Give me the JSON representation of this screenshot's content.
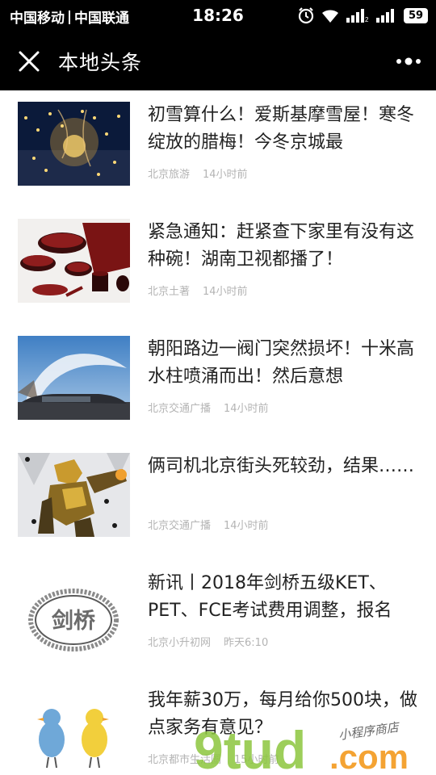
{
  "status_bar": {
    "carrier1": "中国移动",
    "carrier2": "中国联通",
    "time": "18:26",
    "battery": "59",
    "icons": [
      "alarm-icon",
      "wifi-icon",
      "signal-icon",
      "signal-icon"
    ]
  },
  "title_bar": {
    "title": "本地头条",
    "close_icon": "close-icon",
    "more_icon": "more-icon"
  },
  "articles": [
    {
      "title": "初雪算什么！爱斯基摩雪屋！寒冬绽放的腊梅！今冬京城最",
      "source": "北京旅游",
      "time": "14小时前",
      "image": "snow-lights-image"
    },
    {
      "title": "紧急通知：赶紧查下家里有没有这种碗！湖南卫视都播了！",
      "source": "北京土著",
      "time": "14小时前",
      "image": "lacquer-bowls-image"
    },
    {
      "title": "朝阳路边一阀门突然损坏！十米高水柱喷涌而出！然后意想",
      "source": "北京交通广播",
      "time": "14小时前",
      "image": "water-column-image"
    },
    {
      "title": "俩司机北京街头死较劲，结果……",
      "source": "北京交通广播",
      "time": "14小时前",
      "image": "robot-image"
    },
    {
      "title": "新讯丨2018年剑桥五级KET、PET、FCE考试费用调整，报名",
      "source": "北京小升初网",
      "time": "昨天6:10",
      "image": "cambridge-logo-image",
      "image_text": "剑桥"
    },
    {
      "title": "我年薪30万，每月给你500块，做点家务有意见？",
      "source": "北京都市生活圈",
      "time": "15小时前",
      "image": "cartoon-birds-image"
    }
  ],
  "watermark": {
    "text": "9tud",
    "suffix": ".com",
    "tagline": "小程序商店"
  },
  "colors": {
    "header_bg": "#000000",
    "title_text": "#222222",
    "meta_text": "#b4b4b4",
    "watermark_green": "#8cc63e",
    "watermark_orange": "#f39a1e"
  }
}
